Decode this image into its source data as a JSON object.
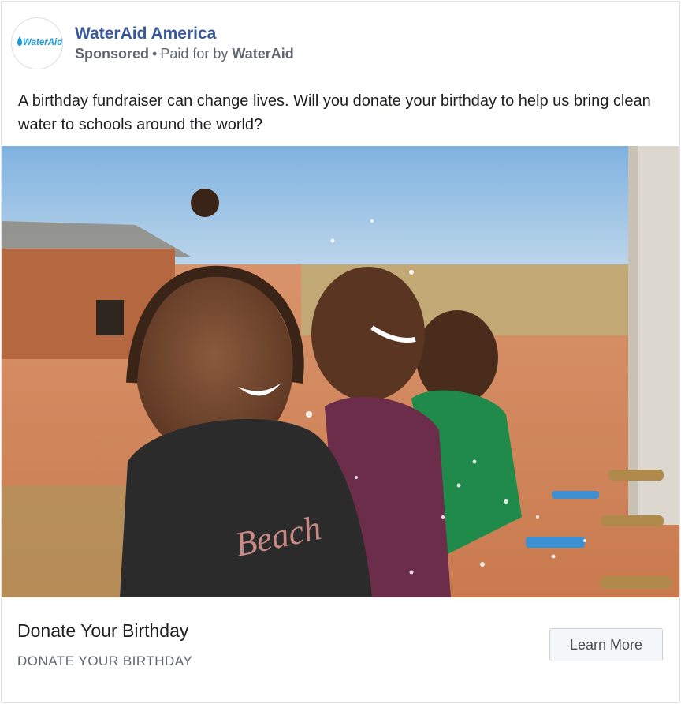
{
  "post": {
    "page_name": "WaterAid America",
    "sponsored_label": "Sponsored",
    "separator": "•",
    "paid_for_prefix": "Paid for by",
    "paid_for_name": "WaterAid",
    "avatar_logo_text": "WaterAid",
    "body_text": "A birthday fundraiser can change lives. Will you donate your birthday to help us bring clean water to schools around the world?"
  },
  "image": {
    "semantic": "children-washing-hands-photo",
    "colors": {
      "sky": "#9cc3e6",
      "ground": "#d98a5c",
      "shirt1": "#2b2b2b",
      "shirt2": "#6b2d4a",
      "shirt3": "#1f8a4a"
    }
  },
  "link_preview": {
    "headline": "Donate Your Birthday",
    "description": "DONATE YOUR BIRTHDAY",
    "cta_label": "Learn More"
  },
  "colors": {
    "page_name": "#385898",
    "secondary_text": "#606770",
    "primary_text": "#1c1e21",
    "logo_blue": "#1e9ad6"
  }
}
